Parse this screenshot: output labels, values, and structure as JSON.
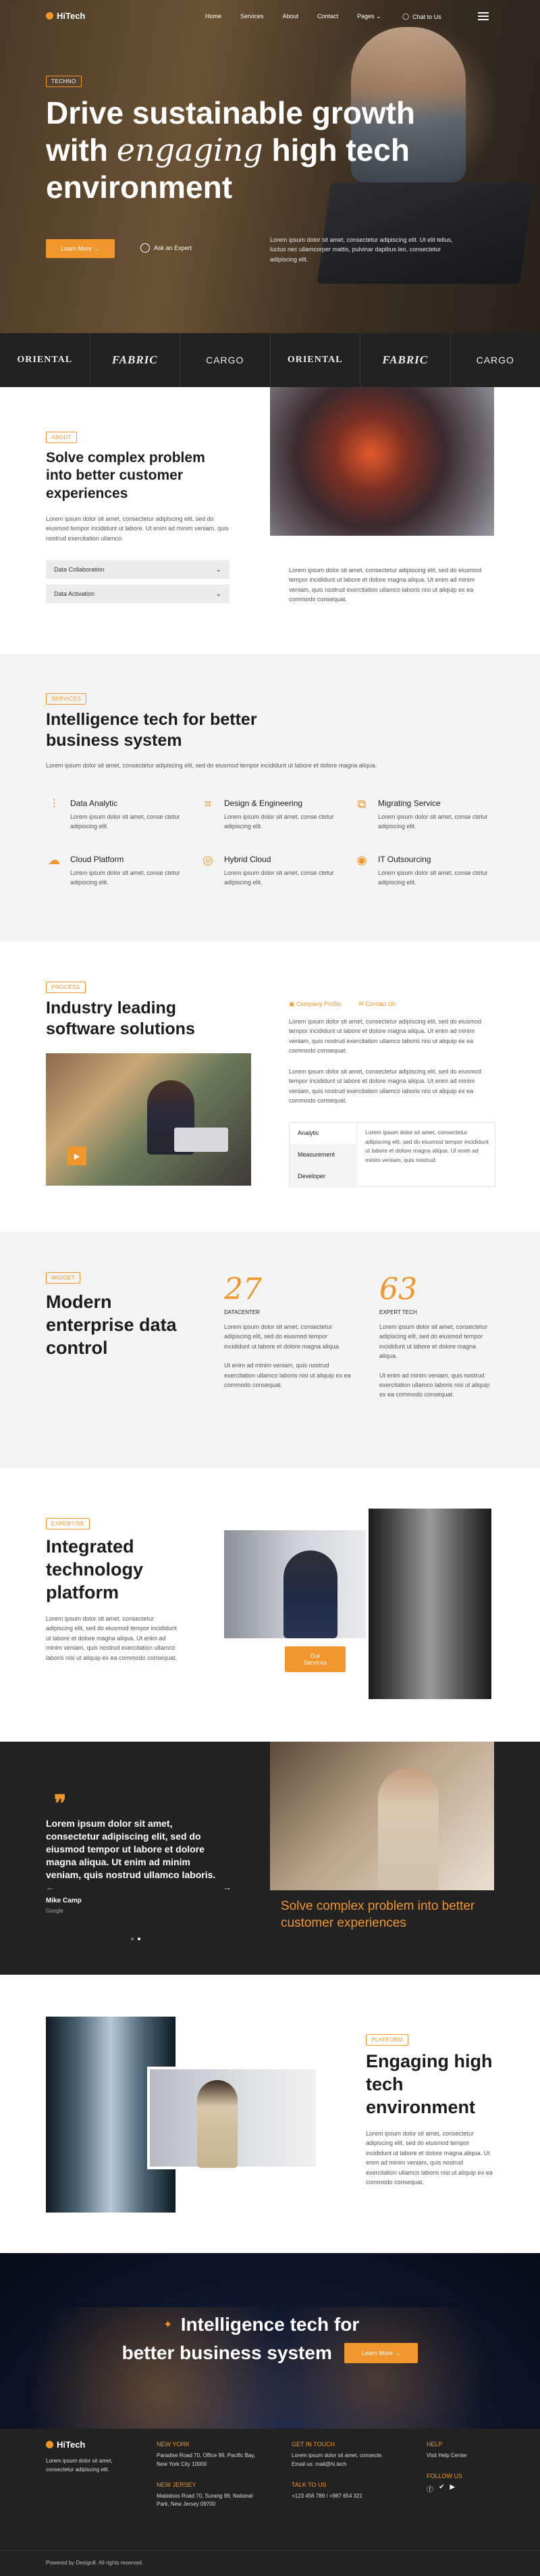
{
  "nav": {
    "brand": "HiTech",
    "menu": [
      "Home",
      "Services",
      "About",
      "Contact",
      "Pages"
    ],
    "chat": "Chat to Us"
  },
  "hero": {
    "tag": "TECHNO",
    "title_line1": "Drive sustainable growth",
    "title_with": "with",
    "title_em": "engaging",
    "title_rest": "high tech",
    "title_line3": "environment",
    "cta": "Learn More",
    "expert": "Ask an Expert",
    "desc": "Lorem ipsum dolor sit amet, consectetur adipiscing elit. Ut elit tellus, luctus nec ullamcorper mattis, pulvinar dapibus leo, consectetur adipiscing elit."
  },
  "logos": [
    "ORIENTAL",
    "FABRIC",
    "CARGO",
    "ORIENTAL",
    "FABRIC",
    "CARGO"
  ],
  "about": {
    "tag": "ABOUT",
    "title": "Solve complex problem into better customer experiences",
    "text": "Lorem ipsum dolor sit amet, consectetur adipiscing elit, sed do eiusmod tempor incididunt ut labore. Ut enim ad minim veniam, quis nostrud exercitation ullamco.",
    "accordion": [
      "Data Collaboration",
      "Data Activation"
    ],
    "right_text": "Lorem ipsum dolor sit amet, consectetur adipiscing elit, sed do eiusmod tempor incididunt ut labore et dolore magna aliqua. Ut enim ad minim veniam, quis nostrud exercitation ullamco laboris nisi ut aliquip ex ea commodo consequat."
  },
  "services": {
    "tag": "SERVICES",
    "title": "Intelligence tech for better business system",
    "text": "Lorem ipsum dolor sit amet, consectetur adipiscing elit, sed do eiusmod tempor incididunt ut labore et dolore magna aliqua.",
    "items": [
      {
        "title": "Data Analytic",
        "text": "Lorem ipsum dolor sit amet, conse ctetur adipiscing elit.",
        "icon": "chart-icon"
      },
      {
        "title": "Design & Engineering",
        "text": "Lorem ipsum dolor sit amet, conse ctetur adipiscing elit.",
        "icon": "crop-icon"
      },
      {
        "title": "Migrating Service",
        "text": "Lorem ipsum dolor sit amet, conse ctetur adipiscing elit.",
        "icon": "migrate-icon"
      },
      {
        "title": "Cloud Platform",
        "text": "Lorem ipsum dolor sit amet, conse ctetur adipiscing elit.",
        "icon": "cloud-icon"
      },
      {
        "title": "Hybrid Cloud",
        "text": "Lorem ipsum dolor sit amet, conse ctetur adipiscing elit.",
        "icon": "fingerprint-icon"
      },
      {
        "title": "IT Outsourcing",
        "text": "Lorem ipsum dolor sit amet, conse ctetur adipiscing elit.",
        "icon": "target-icon"
      }
    ]
  },
  "process": {
    "tag": "PROCESS",
    "title": "Industry leading software solutions",
    "link1": "Company Profile",
    "link2": "Contact Us",
    "text1": "Lorem ipsum dolor sit amet, consectetur adipiscing elit, sed do eiusmod tempor incididunt ut labore et dolore magna aliqua. Ut enim ad minim veniam, quis nostrud exercitation ullamco laboris nisi ut aliquip ex ea commodo consequat.",
    "text2": "Lorem ipsum dolor sit amet, consectetur adipiscing elit, sed do eiusmod tempor incididunt ut labore et dolore magna aliqua. Ut enim ad minim veniam, quis nostrud exercitation ullamco laboris nisi ut aliquip ex ea commodo consequat.",
    "tabs": [
      "Analytic",
      "Measurement",
      "Developer"
    ],
    "tab_text": "Lorem ipsum dolor sit amet, consectetur adipiscing elit, sed do eiusmod tempor incididunt ut labore et dolore magna aliqua. Ut enim ad minim veniam, quis nostrud."
  },
  "data": {
    "tag": "WIDGET",
    "title": "Modern enterprise data control",
    "stats": [
      {
        "num": "27",
        "label": "DATACENTER",
        "text1": "Lorem ipsum dolor sit amet, consectetur adipiscing elit, sed do eiusmod tempor incididunt ut labore et dolore magna aliqua.",
        "text2": "Ut enim ad minim veniam, quis nostrud exercitation ullamco laboris nisi ut aliquip ex ea commodo consequat."
      },
      {
        "num": "63",
        "label": "EXPERT TECH",
        "text1": "Lorem ipsum dolor sit amet, consectetur adipiscing elit, sed do eiusmod tempor incididunt ut labore et dolore magna aliqua.",
        "text2": "Ut enim ad minim veniam, quis nostrud exercitation ullamco laboris nisi ut aliquip ex ea commodo consequat."
      }
    ]
  },
  "expertise": {
    "tag": "EXPERTISE",
    "title": "Integrated technology platform",
    "text": "Lorem ipsum dolor sit amet, consectetur adipiscing elit, sed do eiusmod tempor incididunt ut labore et dolore magna aliqua. Ut enim ad minim veniam, quis nostrud exercitation ullamco laboris nisi ut aliquip ex ea commodo consequat.",
    "button": "Our Services"
  },
  "testimonial": {
    "quote": "Lorem ipsum dolor sit amet, consectetur adipiscing elit, sed do eiusmod tempor ut labore et dolore magna aliqua. Ut enim ad minim veniam, quis nostrud ullamco laboris.",
    "name": "Mike Camp",
    "company": "Google",
    "headline": "Solve complex problem into better customer experiences"
  },
  "platform": {
    "tag": "PLATFORM",
    "title": "Engaging high tech environment",
    "text": "Lorem ipsum dolor sit amet, consectetur adipiscing elit, sed do eiusmod tempor incididunt ut labore et dolore magna aliqua. Ut enim ad minim veniam, quis nostrud exercitation ullamco laboris nisi ut aliquip ex ea commodo consequat."
  },
  "cta": {
    "line1": "Intelligence tech for",
    "line2": "better business system",
    "button": "Learn More"
  },
  "footer": {
    "brand": "HiTech",
    "about": "Lorem ipsum dolor sit amet, consectetur adipiscing elit.",
    "ny_title": "NEW YORK",
    "ny_text": "Paradise Road 70, Office 99, Pacific Bay, New York City 10000",
    "nj_title": "NEW JERSEY",
    "nj_text": "Mabidoos Road 70, Surang 99, National Park, New Jersey 09700",
    "git_title": "GET IN TOUCH",
    "git_text": "Lorem ipsum dolor sit amet, consecte. Email us: mail@hi.tech",
    "talk_title": "TALK TO US",
    "talk_text": "+123 456 789 / +987 654 321",
    "help_title": "HELP",
    "help_text": "Visit Help Center",
    "follow_title": "FOLLOW US",
    "copyright": "Powered by Design8. All rights reserved."
  },
  "colors": {
    "accent": "#f0962b",
    "dark": "#222222",
    "light": "#f4f4f4"
  }
}
